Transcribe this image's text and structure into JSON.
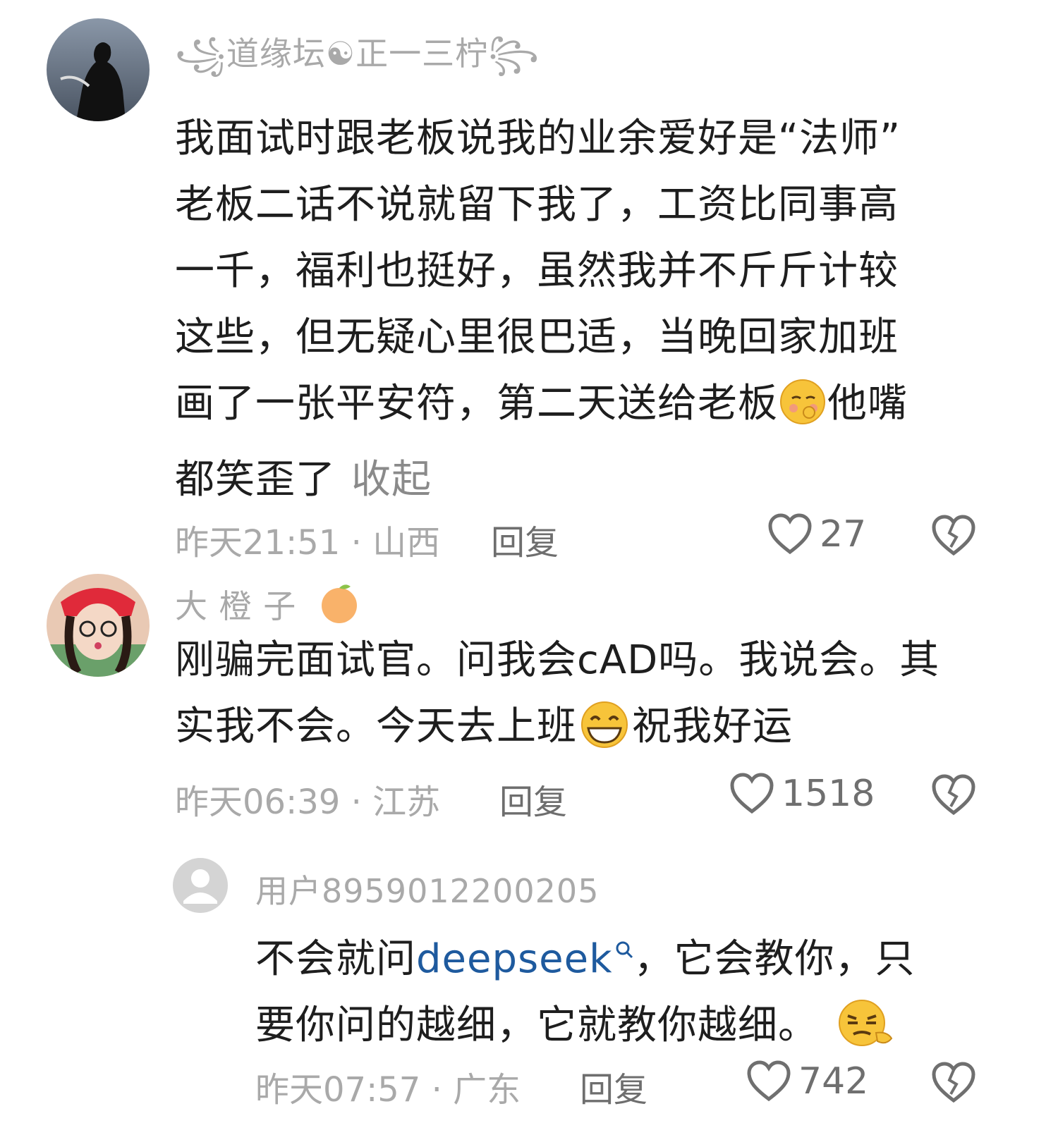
{
  "comments": [
    {
      "username": "꧁道缘坛☯正一三柠꧂",
      "text_lines": [
        "我面试时跟老板说我的业余爱好是“法师”",
        "老板二话不说就留下我了，工资比同事高",
        "一千，福利也挺好，虽然我并不斤斤计较",
        "这些，但无疑心里很巴适，当晚回家加班"
      ],
      "text_line5_a": "画了一张平安符，第二天送给老板",
      "text_line5_b": "他嘴",
      "text_line6": "都笑歪了",
      "collapse_label": "收起",
      "time_location": "昨天21:51 · 山西",
      "reply_label": "回复",
      "likes": "27"
    },
    {
      "username": "大 橙 子",
      "text_line1": "刚骗完面试官。问我会cAD吗。我说会。其",
      "text_line2_a": "实我不会。今天去上班",
      "text_line2_b": "祝我好运",
      "time_location": "昨天06:39 · 江苏",
      "reply_label": "回复",
      "likes": "1518"
    },
    {
      "username": "用户8959012200205",
      "text_line1_a": "不会就问",
      "text_line1_link": "deepseek",
      "text_line1_b": "，它会教你，只",
      "text_line2": "要你问的越细，它就教你越细。",
      "time_location": "昨天07:57 · 广东",
      "reply_label": "回复",
      "likes": "742"
    }
  ],
  "colors": {
    "text": "#1e1e1e",
    "meta": "#a9a9a9",
    "link": "#1e5a9e"
  }
}
